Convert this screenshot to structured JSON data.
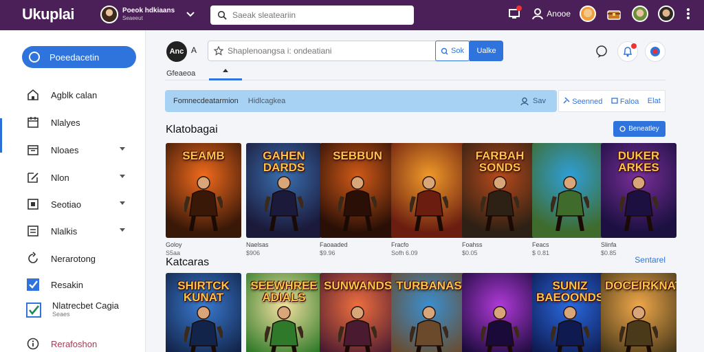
{
  "colors": {
    "topbar": "#4b1f57",
    "accent": "#2f74dd",
    "banner": "#a8d2f4",
    "notice": "#e33333"
  },
  "topbar": {
    "logo": "Ukuplai",
    "profile": {
      "name": "Poeok hdkiaans",
      "sub": "Seaeeut"
    },
    "search_placeholder": "Saeak sleateariin",
    "user_label": "Anooe",
    "icons": [
      "store-icon",
      "user-icon",
      "avatar-icon",
      "chest-icon",
      "avatar-icon",
      "avatar-icon",
      "more-icon"
    ]
  },
  "sidebar": {
    "primary": "Poeedacetin",
    "items": [
      {
        "label": "Agblk calan",
        "icon": "home-icon",
        "caret": false
      },
      {
        "label": "Nlalyes",
        "icon": "calendar-icon",
        "caret": false
      },
      {
        "label": "Nloaes",
        "icon": "calendar-icon",
        "caret": true
      },
      {
        "label": "Nlon",
        "icon": "edit-icon",
        "caret": true
      },
      {
        "label": "Seotiao",
        "icon": "square-icon",
        "caret": true
      },
      {
        "label": "Nlalkis",
        "icon": "document-icon",
        "caret": true
      },
      {
        "label": "Nerarotong",
        "icon": "refresh-icon",
        "caret": false
      },
      {
        "label": "Resakin",
        "icon": "check-icon",
        "caret": false
      },
      {
        "label": "Nlatrecbet Cagia",
        "sub": "Seaes",
        "icon": "check-icon",
        "caret": false
      },
      {
        "label": "Rerafoshon",
        "icon": "info-icon",
        "caret": false
      }
    ]
  },
  "main": {
    "brand_badge": "Anc",
    "brand_mark": "A",
    "search_placeholder": "Shaplenoangsa i: ondeatiani",
    "seek_label": "Sok",
    "unlike_label": "Ualke",
    "tab_label": "Gfeaeoa",
    "banner": {
      "left": "Fomnecdeatarmion",
      "mid": "Hidlcagkea",
      "right": "Sav"
    },
    "banner_actions": [
      "Seenned",
      "Faloa",
      "Elat"
    ],
    "section1": {
      "title": "Klatobagai",
      "button": "Beneatley"
    },
    "section2": {
      "title": "Katcaras",
      "link": "Sentarel"
    }
  },
  "cards_row1": [
    {
      "title": "SEAMB",
      "caption": "Goloy",
      "price": "S5aa",
      "colors": [
        "#f26b1d",
        "#3a1808"
      ]
    },
    {
      "title": "GAHEN DARDS",
      "caption": "Naelsas",
      "price": "$906",
      "colors": [
        "#3a6fb0",
        "#1b1a3a"
      ]
    },
    {
      "title": "SEBBUN",
      "caption": "Faoaaded",
      "price": "$9.96",
      "colors": [
        "#d15a18",
        "#2a0f06"
      ]
    },
    {
      "title": "",
      "caption": "Fracfo",
      "price": "Sofh 6.09",
      "colors": [
        "#f09a2a",
        "#6b1e10"
      ]
    },
    {
      "title": "FARBAH SONDS",
      "caption": "Foahss",
      "price": "$0.05",
      "colors": [
        "#b74a1c",
        "#2d2014"
      ]
    },
    {
      "title": "",
      "caption": "Feacs",
      "price": "$ 0.81",
      "colors": [
        "#2f9fd8",
        "#3f6b2c"
      ]
    },
    {
      "title": "DUKER ARKES",
      "caption": "Slinfa",
      "price": "$0.85",
      "colors": [
        "#7a2f9a",
        "#1b1040"
      ]
    }
  ],
  "cards_row2": [
    {
      "title": "SHIRTCK KUNAT",
      "colors": [
        "#3a7bd0",
        "#12244a"
      ]
    },
    {
      "title": "SEEWHREE ADIALS",
      "colors": [
        "#f4e1a0",
        "#2f7a2a"
      ]
    },
    {
      "title": "SUNWANDS",
      "colors": [
        "#ef6f3f",
        "#4a1a30"
      ]
    },
    {
      "title": "TURBANAS",
      "colors": [
        "#3a8fd0",
        "#6a4a2a"
      ]
    },
    {
      "title": "",
      "colors": [
        "#b03ad8",
        "#1a0a3a"
      ]
    },
    {
      "title": "SUNIZ BAEOONDS",
      "colors": [
        "#2a6ae0",
        "#0e1a50"
      ]
    },
    {
      "title": "DOCEIRKNAT",
      "colors": [
        "#f0a84a",
        "#4a3a1a"
      ]
    }
  ]
}
